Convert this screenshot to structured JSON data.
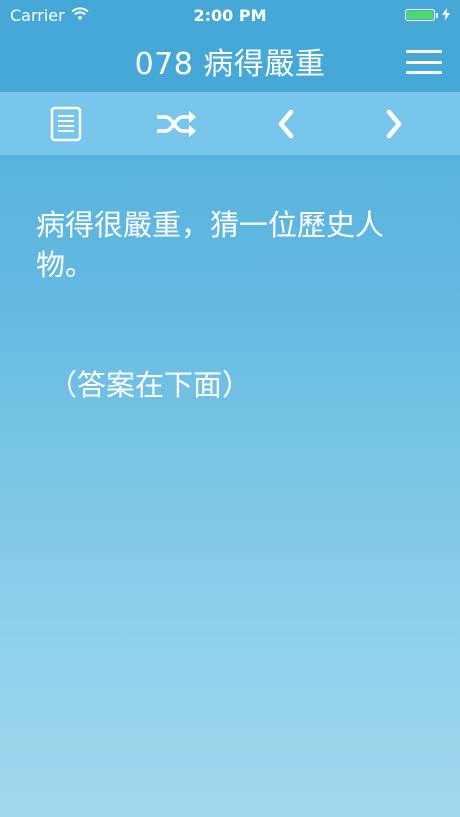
{
  "status_bar": {
    "carrier": "Carrier",
    "time": "2:00 PM",
    "battery_level": 1.0,
    "icons": [
      "wifi-icon",
      "battery-icon",
      "charging-bolt-icon"
    ]
  },
  "nav": {
    "title": "078 病得嚴重",
    "menu_icon": "hamburger-menu-icon"
  },
  "toolbar": {
    "items": [
      {
        "icon": "document-list-icon"
      },
      {
        "icon": "shuffle-icon"
      },
      {
        "icon": "chevron-left-icon"
      },
      {
        "icon": "chevron-right-icon"
      }
    ]
  },
  "content": {
    "question": "病得很嚴重，猜一位歷史人物。",
    "answer_hint": "（答案在下面）"
  },
  "colors": {
    "nav_background": "#46a8d6",
    "toolbar_background": "#79c6ec",
    "text": "#ffffff",
    "battery": "#4cd964"
  }
}
